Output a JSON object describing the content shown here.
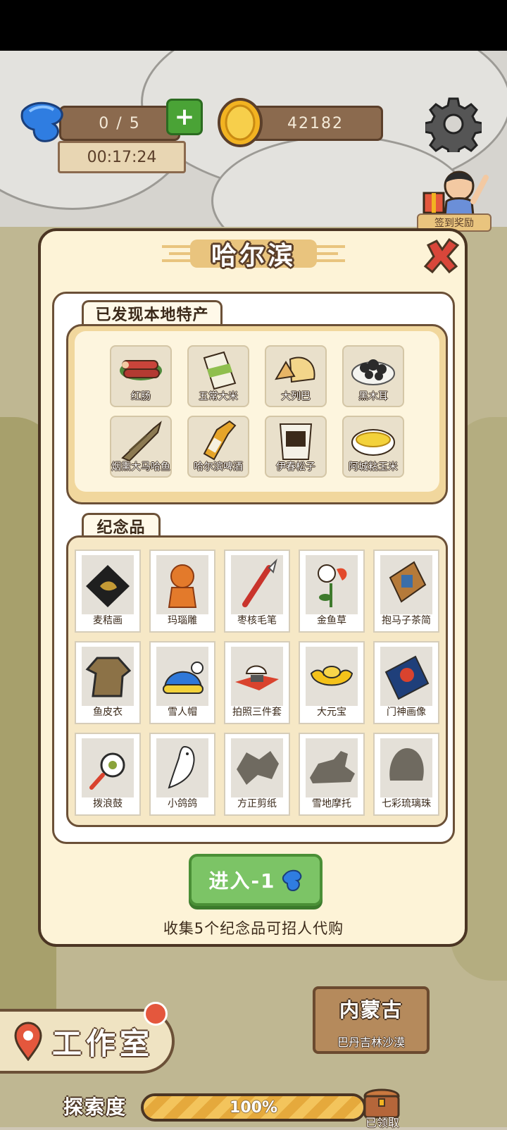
{
  "hud": {
    "energy": "0 / 5",
    "timer": "00:17:24",
    "coins": "42182",
    "signin_label": "签到奖励"
  },
  "modal": {
    "title": "哈尔滨",
    "specialties_tab": "已发现本地特产",
    "specialties": [
      {
        "label": "红肠",
        "icon": "sausage-icon"
      },
      {
        "label": "五常大米",
        "icon": "rice-bag-icon"
      },
      {
        "label": "大列巴",
        "icon": "bread-icon"
      },
      {
        "label": "黑木耳",
        "icon": "black-fungus-icon"
      },
      {
        "label": "烟熏大马哈鱼",
        "icon": "smoked-fish-icon"
      },
      {
        "label": "哈尔滨啤酒",
        "icon": "beer-bottle-icon"
      },
      {
        "label": "伊春松子",
        "icon": "pine-nuts-icon"
      },
      {
        "label": "阿城粘玉米",
        "icon": "corn-icon"
      }
    ],
    "souvenirs_tab": "纪念品",
    "souvenirs": [
      {
        "label": "麦秸画",
        "icon": "straw-painting-icon",
        "collected": true
      },
      {
        "label": "玛瑙雕",
        "icon": "agate-carving-icon",
        "collected": true
      },
      {
        "label": "枣核毛笔",
        "icon": "brush-pen-icon",
        "collected": true
      },
      {
        "label": "金鱼草",
        "icon": "snapdragon-icon",
        "collected": true
      },
      {
        "label": "抱马子茶简",
        "icon": "tea-tin-icon",
        "collected": true
      },
      {
        "label": "鱼皮衣",
        "icon": "fish-skin-coat-icon",
        "collected": true
      },
      {
        "label": "雪人帽",
        "icon": "snow-hat-icon",
        "collected": true
      },
      {
        "label": "拍照三件套",
        "icon": "photo-set-icon",
        "collected": true
      },
      {
        "label": "大元宝",
        "icon": "gold-ingot-icon",
        "collected": true
      },
      {
        "label": "门神画像",
        "icon": "door-god-icon",
        "collected": true
      },
      {
        "label": "拨浪鼓",
        "icon": "rattle-drum-icon",
        "collected": true
      },
      {
        "label": "小鸽鸽",
        "icon": "dove-icon",
        "collected": true
      },
      {
        "label": "方正剪纸",
        "icon": "paper-cut-icon",
        "collected": false
      },
      {
        "label": "雪地摩托",
        "icon": "snowmobile-icon",
        "collected": false
      },
      {
        "label": "七彩琉璃珠",
        "icon": "glass-bead-icon",
        "collected": false
      }
    ],
    "enter_button": "进入-1",
    "hint": "收集5个纪念品可招人代购"
  },
  "map": {
    "studio_label": "工作室",
    "next_region": "内蒙古",
    "next_region_sub": "巴丹吉林沙漠",
    "explore_label": "探索度",
    "explore_progress": 1.0,
    "explore_text": "100%",
    "claimed_label": "已领取"
  },
  "colors": {
    "modal_bg": "#fdf3d7",
    "frame_brown": "#6b5037",
    "button_green": "#7cc466",
    "coin_gold": "#f2b321",
    "energy_blue": "#2f7de1"
  }
}
